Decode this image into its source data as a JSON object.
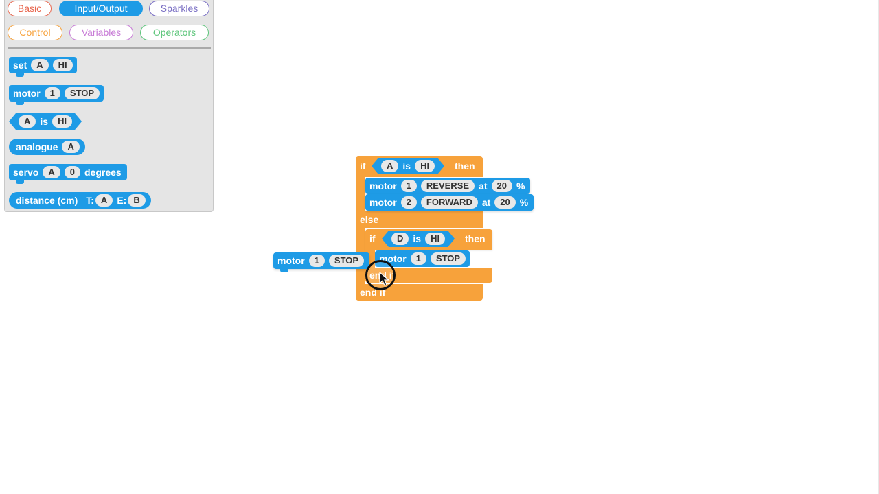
{
  "categories": [
    {
      "label": "Basic",
      "color": "#e8674f"
    },
    {
      "label": "Input/Output",
      "color": "#1e9be6",
      "active": true
    },
    {
      "label": "Sparkles",
      "color": "#7a6fc4"
    },
    {
      "label": "Control",
      "color": "#f7a23b"
    },
    {
      "label": "Variables",
      "color": "#c77ad6"
    },
    {
      "label": "Operators",
      "color": "#5cc57a"
    }
  ],
  "palette": {
    "set": {
      "label": "set",
      "pin": "A",
      "value": "HI"
    },
    "motor": {
      "label": "motor",
      "num": "1",
      "action": "STOP"
    },
    "is": {
      "pin": "A",
      "label": "is",
      "value": "HI"
    },
    "analogue": {
      "label": "analogue",
      "pin": "A"
    },
    "servo": {
      "label": "servo",
      "pin": "A",
      "value": "0",
      "unit": "degrees"
    },
    "distance": {
      "label": "distance (cm)",
      "t_label": "T:",
      "t_pin": "A",
      "e_label": "E:",
      "e_pin": "B"
    }
  },
  "script": {
    "if_label": "if",
    "then_label": "then",
    "else_label": "else",
    "end_if_label": "end if",
    "cond1": {
      "pin": "A",
      "label": "is",
      "value": "HI"
    },
    "motor1": {
      "label": "motor",
      "num": "1",
      "action": "REVERSE",
      "at": "at",
      "speed": "20",
      "pct": "%"
    },
    "motor2": {
      "label": "motor",
      "num": "2",
      "action": "FORWARD",
      "at": "at",
      "speed": "20",
      "pct": "%"
    },
    "cond2": {
      "pin": "D",
      "label": "is",
      "value": "HI"
    },
    "motor3": {
      "label": "motor",
      "num": "1",
      "action": "STOP"
    },
    "dragging": {
      "label": "motor",
      "num": "1",
      "action": "STOP"
    }
  }
}
